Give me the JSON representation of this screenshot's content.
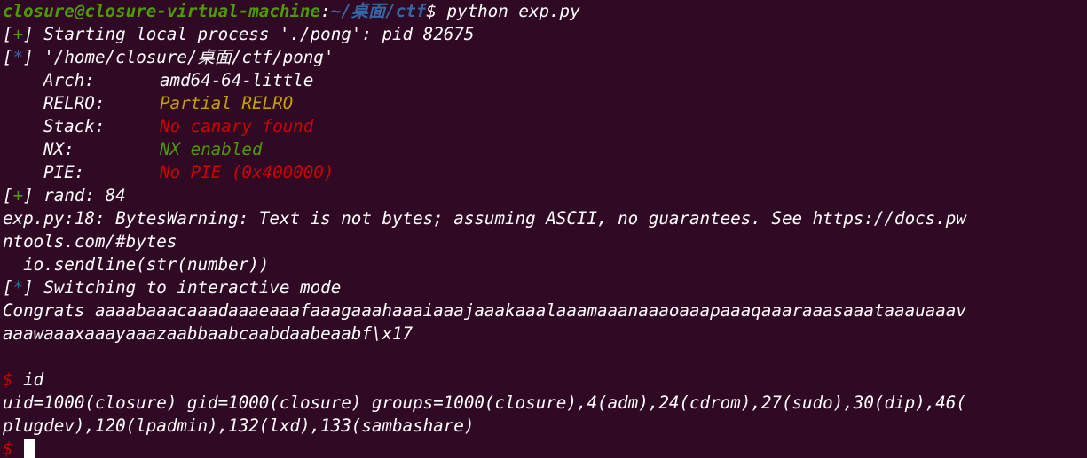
{
  "prompt_line": {
    "user_host": "closure@closure-virtual-machine",
    "colon": ":",
    "path": "~/桌面/ctf",
    "dollar": "$",
    "command": " python exp.py"
  },
  "lines": {
    "start_process": {
      "marker": "+",
      "text": " Starting local process './pong': pid 82675"
    },
    "binary_path": {
      "marker": "*",
      "text": " '/home/closure/桌面/ctf/pong'"
    }
  },
  "checksec": {
    "arch": {
      "key": "Arch:",
      "value": "amd64-64-little"
    },
    "relro": {
      "key": "RELRO:",
      "value": "Partial RELRO"
    },
    "stack": {
      "key": "Stack:",
      "value": "No canary found"
    },
    "nx": {
      "key": "NX:",
      "value": "NX enabled"
    },
    "pie": {
      "key": "PIE:",
      "value": "No PIE (0x400000)"
    }
  },
  "rand_line": {
    "marker": "+",
    "text": " rand: 84"
  },
  "warning": {
    "line1": "exp.py:18: BytesWarning: Text is not bytes; assuming ASCII, no guarantees. See https://docs.pw",
    "line2": "ntools.com/#bytes",
    "line3": "  io.sendline(str(number))"
  },
  "interactive_line": {
    "marker": "*",
    "text": " Switching to interactive mode"
  },
  "congrats": {
    "line1": "Congrats aaaabaaacaaadaaaeaaafaaagaaahaaaiaaajaaakaaalaaamaaanaaaoaaapaaaqaaaraaasaaataaauaaav",
    "line2": "aaawaaaxaaayaaazaabbaabcaabdaabeaabf\\x17"
  },
  "id_command": {
    "dollar": "$",
    "text": " id"
  },
  "id_output": {
    "line1": "uid=1000(closure) gid=1000(closure) groups=1000(closure),4(adm),24(cdrom),27(sudo),30(dip),46(",
    "line2": "plugdev),120(lpadmin),132(lxd),133(sambashare)"
  },
  "final_prompt": {
    "dollar": "$"
  },
  "colors": {
    "background": "#300a24",
    "foreground": "#ffffff",
    "green": "#4e9a06",
    "blue": "#3465a4",
    "yellow": "#c4a000",
    "red": "#cc0000"
  }
}
